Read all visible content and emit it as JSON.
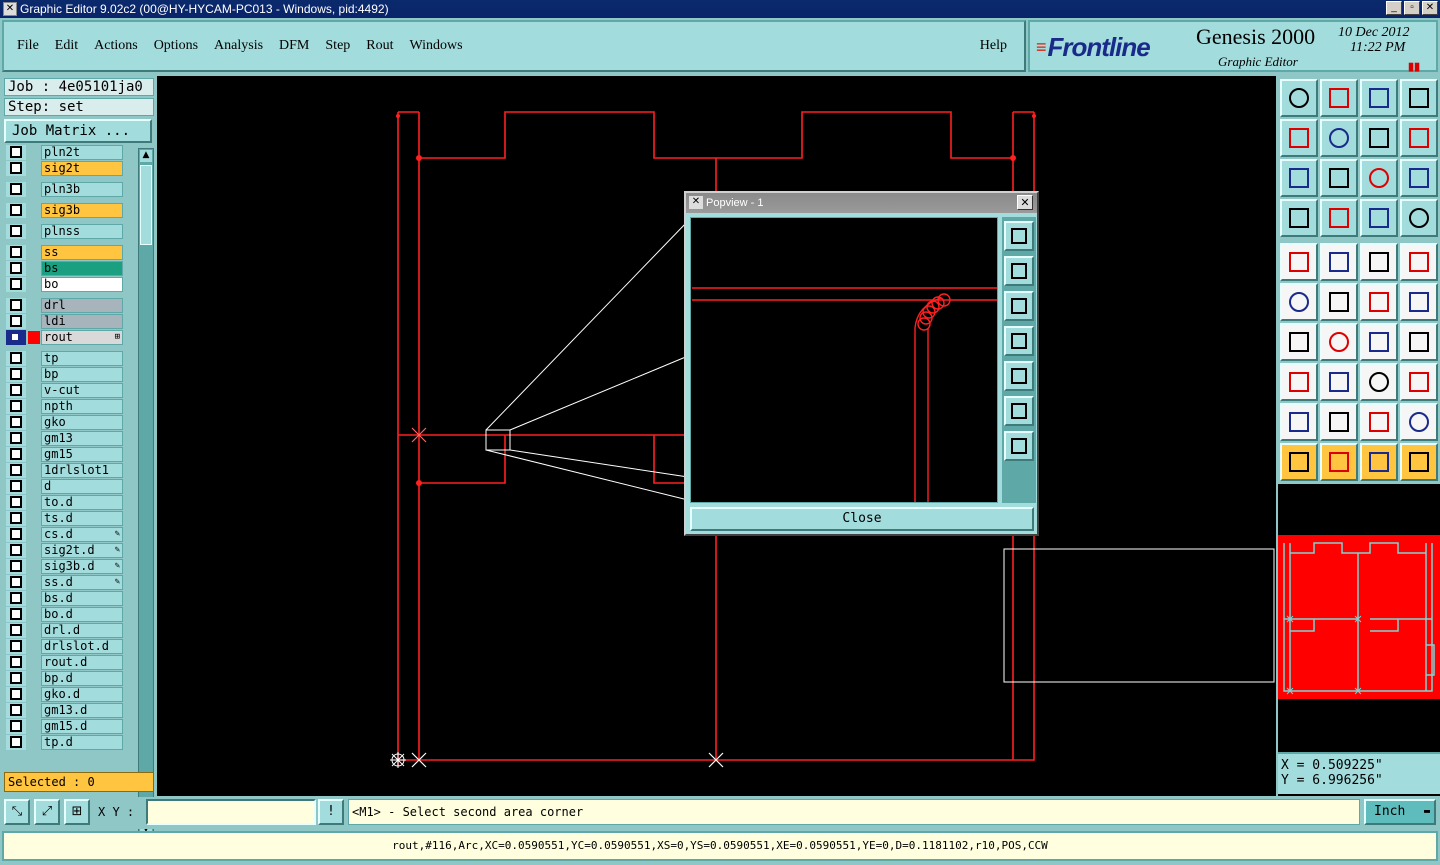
{
  "window": {
    "title": "Graphic Editor 9.02c2 (00@HY-HYCAM-PC013 - Windows, pid:4492)",
    "minimize": "_",
    "maximize": "▫",
    "close": "✕"
  },
  "menu": {
    "items": [
      "File",
      "Edit",
      "Actions",
      "Options",
      "Analysis",
      "DFM",
      "Step",
      "Rout",
      "Windows"
    ],
    "help": "Help"
  },
  "brand": {
    "logo": "Frontline",
    "product": "Genesis 2000",
    "subtitle": "Graphic Editor",
    "date": "10 Dec 2012",
    "time": "11:22 PM",
    "pause_glyph": "▮▮"
  },
  "job": {
    "job_label": "Job : 4e05101ja0",
    "step_label": "Step: set",
    "matrix_button": "Job Matrix ..."
  },
  "layers": [
    {
      "name": "pln2t",
      "color": "#a3dcdc",
      "partial": true
    },
    {
      "name": "sig2t",
      "color": "#ffc440"
    },
    {
      "name": "pln3b",
      "color": "#a3dcdc"
    },
    {
      "name": "sig3b",
      "color": "#ffc440"
    },
    {
      "name": "plnss",
      "color": "#a3dcdc"
    },
    {
      "name": "ss",
      "color": "#ffc440"
    },
    {
      "name": "bs",
      "color": "#1aa080"
    },
    {
      "name": "bo",
      "color": "#ffffff"
    },
    {
      "name": "drl",
      "color": "#a8b4bc"
    },
    {
      "name": "ldi",
      "color": "#a8b4bc"
    },
    {
      "name": "rout",
      "color": "#d9d9d9",
      "active": true
    },
    {
      "name": "tp",
      "color": "#a3dcdc"
    },
    {
      "name": "bp",
      "color": "#a3dcdc"
    },
    {
      "name": "v-cut",
      "color": "#a3dcdc"
    },
    {
      "name": "npth",
      "color": "#a3dcdc"
    },
    {
      "name": "gko",
      "color": "#a3dcdc"
    },
    {
      "name": "gm13",
      "color": "#a3dcdc"
    },
    {
      "name": "gm15",
      "color": "#a3dcdc"
    },
    {
      "name": "1drlslot1",
      "color": "#a3dcdc"
    },
    {
      "name": "d",
      "color": "#a3dcdc"
    },
    {
      "name": "to.d",
      "color": "#a3dcdc"
    },
    {
      "name": "ts.d",
      "color": "#a3dcdc"
    },
    {
      "name": "cs.d",
      "color": "#a3dcdc",
      "edit": true
    },
    {
      "name": "sig2t.d",
      "color": "#a3dcdc",
      "edit": true
    },
    {
      "name": "sig3b.d",
      "color": "#a3dcdc",
      "edit": true
    },
    {
      "name": "ss.d",
      "color": "#a3dcdc",
      "edit": true
    },
    {
      "name": "bs.d",
      "color": "#a3dcdc"
    },
    {
      "name": "bo.d",
      "color": "#a3dcdc"
    },
    {
      "name": "drl.d",
      "color": "#a3dcdc"
    },
    {
      "name": "drlslot.d",
      "color": "#a3dcdc"
    },
    {
      "name": "rout.d",
      "color": "#a3dcdc"
    },
    {
      "name": "bp.d",
      "color": "#a3dcdc"
    },
    {
      "name": "gko.d",
      "color": "#a3dcdc"
    },
    {
      "name": "gm13.d",
      "color": "#a3dcdc"
    },
    {
      "name": "gm15.d",
      "color": "#a3dcdc"
    },
    {
      "name": "tp.d",
      "color": "#a3dcdc"
    }
  ],
  "selected": "Selected : 0",
  "popview": {
    "title": "Popview - 1",
    "close_button": "Close"
  },
  "coords": {
    "x": "X = 0.509225\"",
    "y": "Y = 6.996256\""
  },
  "cmdbar": {
    "xy_label": "X Y :",
    "xy_value": "",
    "prompt": "<M1> - Select second area corner",
    "units": "Inch",
    "units_dropdown": "▬"
  },
  "status": "rout,#116,Arc,XC=0.0590551,YC=0.0590551,XS=0,YS=0.0590551,XE=0.0590551,YE=0,D=0.1181102,r10,POS,CCW",
  "colors": {
    "rout": "#ff0000",
    "accent": "#a3dcdc",
    "highlight": "#ffc440"
  }
}
